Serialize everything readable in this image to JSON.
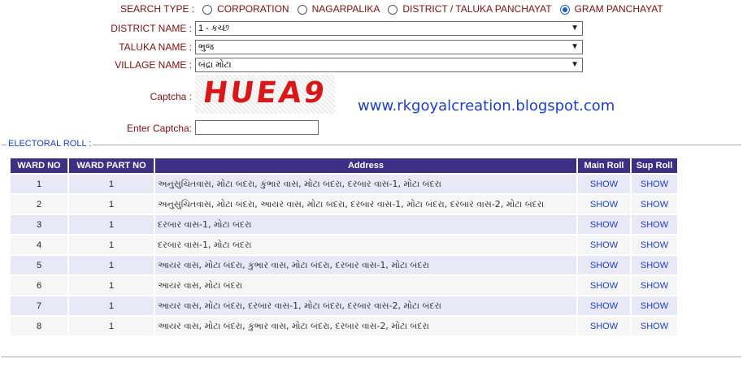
{
  "search": {
    "label": "SEARCH TYPE :",
    "options": [
      {
        "label": "CORPORATION",
        "selected": false
      },
      {
        "label": "NAGARPALIKA",
        "selected": false
      },
      {
        "label": "DISTRICT / TALUKA PANCHAYAT",
        "selected": false
      },
      {
        "label": "GRAM PANCHAYAT",
        "selected": true
      }
    ]
  },
  "form": {
    "district_label": "DISTRICT NAME :",
    "district_value": "1 - કચ્છ",
    "taluka_label": "TALUKA NAME :",
    "taluka_value": "ભુજ",
    "village_label": "VILLAGE NAME :",
    "village_value": "બંદ્રા મોટા",
    "captcha_label": "Captcha :",
    "captcha_text": "HUEA9",
    "enter_captcha_label": "Enter Captcha:",
    "enter_captcha_value": ""
  },
  "watermark": "www.rkgoyalcreation.blogspot.com",
  "electoral_roll": {
    "legend": "ELECTORAL ROLL :",
    "headers": [
      "WARD NO",
      "WARD PART NO",
      "Address",
      "Main Roll",
      "Sup Roll"
    ],
    "rows": [
      {
        "ward": "1",
        "part": "1",
        "address": "અનુસુચિતવાસ, મોટા બંદરા, કુંભાર વાસ, મોટા બંદરા, દરબાર વાસ-1, મોટા બંદરા",
        "main": "SHOW",
        "sup": "SHOW"
      },
      {
        "ward": "2",
        "part": "1",
        "address": "અનુસુચિતવાસ, મોટા બંદરા, આયર વાસ, મોટા બંદરા, દરબાર વાસ-1, મોટા બંદરા, દરબાર વાસ-2, મોટા બંદરા",
        "main": "SHOW",
        "sup": "SHOW"
      },
      {
        "ward": "3",
        "part": "1",
        "address": "દરબાર વાસ-1, મોટા બંદરા",
        "main": "SHOW",
        "sup": "SHOW"
      },
      {
        "ward": "4",
        "part": "1",
        "address": "દરબાર વાસ-1, મોટા બંદરા",
        "main": "SHOW",
        "sup": "SHOW"
      },
      {
        "ward": "5",
        "part": "1",
        "address": "આયર વાસ, મોટા બંદરા, કુંભાર વાસ, મોટા બંદરા, દરબાર વાસ-1, મોટા બંદરા",
        "main": "SHOW",
        "sup": "SHOW"
      },
      {
        "ward": "6",
        "part": "1",
        "address": "આયર વાસ, મોટા બંદરા",
        "main": "SHOW",
        "sup": "SHOW"
      },
      {
        "ward": "7",
        "part": "1",
        "address": "આયર વાસ, મોટા બંદરા, દરબાર વાસ-1, મોટા બંદરા, દરબાર વાસ-2, મોટા બંદરા",
        "main": "SHOW",
        "sup": "SHOW"
      },
      {
        "ward": "8",
        "part": "1",
        "address": "આયર વાસ, મોટા બંદરા, કુંભાર વાસ, મોટા બંદરા, દરબાર વાસ-2, મોટા બંદરા",
        "main": "SHOW",
        "sup": "SHOW"
      }
    ]
  },
  "colors": {
    "header_bg": "#3e2f86",
    "link": "#1b3fc7",
    "label": "#7a1010"
  }
}
